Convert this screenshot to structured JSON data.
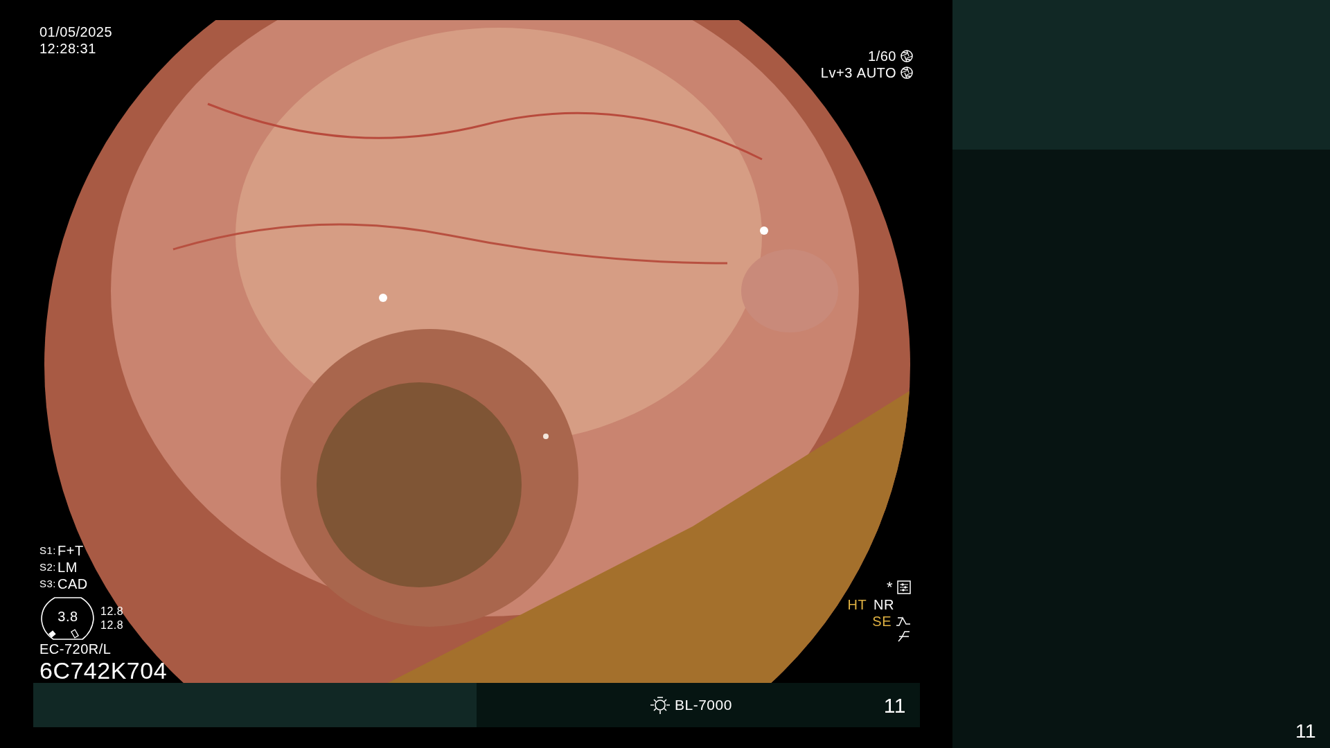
{
  "overlay": {
    "date": "01/05/2025",
    "time": "12:28:31",
    "shutter": "1/60",
    "exposure_level": "Lv+3",
    "exposure_mode": "AUTO",
    "switches": [
      {
        "key": "S1:",
        "value": "F+T"
      },
      {
        "key": "S2:",
        "value": "LM"
      },
      {
        "key": "S3:",
        "value": "CAD"
      }
    ],
    "gauge": {
      "value": "3.8",
      "readings": [
        "12.8",
        "12.8"
      ]
    },
    "scope_model": "EC-720R/L",
    "serial": "6C742K704",
    "marker": "*",
    "enhancements": [
      {
        "label": "HT",
        "color": "#e0b243"
      },
      {
        "label": "NR",
        "color": "#ffffff"
      }
    ],
    "structure_enhancement": {
      "label": "SE",
      "color": "#e0b243"
    }
  },
  "bottom_bar": {
    "light_source": "BL-7000",
    "counter": "11"
  },
  "side_panel": {
    "counter": "11"
  }
}
